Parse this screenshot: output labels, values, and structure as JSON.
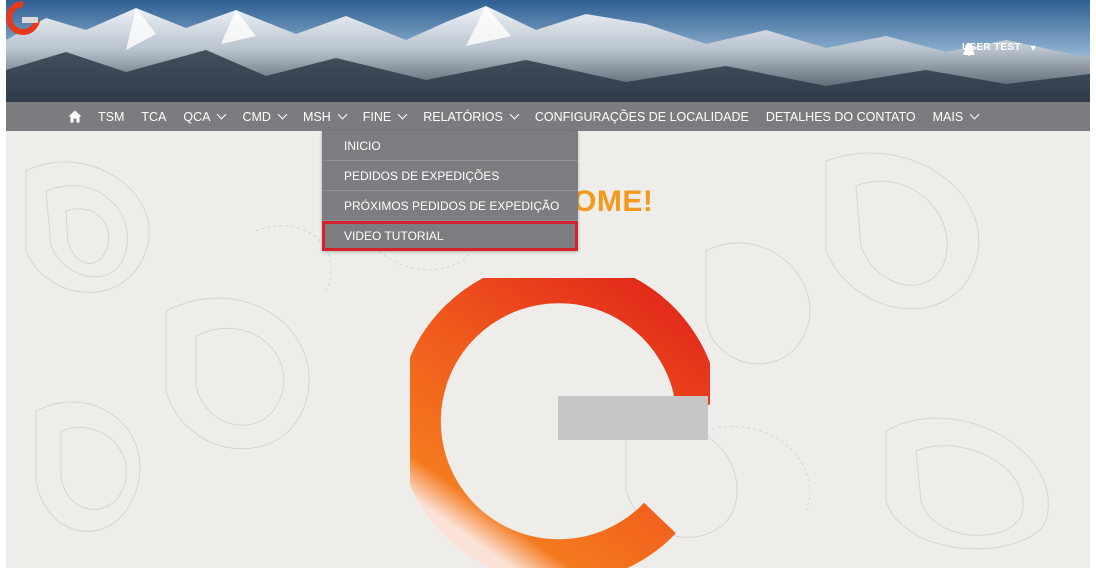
{
  "header": {
    "user_label": "USER TEST",
    "user_caret": "▼"
  },
  "nav": {
    "items": [
      {
        "label": "TSM",
        "dropdown": false
      },
      {
        "label": "TCA",
        "dropdown": false
      },
      {
        "label": "QCA",
        "dropdown": true
      },
      {
        "label": "CMD",
        "dropdown": true
      },
      {
        "label": "MSH",
        "dropdown": true
      },
      {
        "label": "FINE",
        "dropdown": true
      },
      {
        "label": "RELATÓRIOS",
        "dropdown": true
      },
      {
        "label": "CONFIGURAÇÕES DE LOCALIDADE",
        "dropdown": false
      },
      {
        "label": "DETALHES DO CONTATO",
        "dropdown": false
      },
      {
        "label": "MAIS",
        "dropdown": true
      }
    ]
  },
  "dropdown": {
    "items": [
      {
        "label": "INICIO"
      },
      {
        "label": "PEDIDOS DE EXPEDIÇÕES"
      },
      {
        "label": "PRÓXIMOS PEDIDOS DE EXPEDIÇÃO"
      },
      {
        "label": "VIDEO TUTORIAL"
      }
    ]
  },
  "main": {
    "welcome_visible": "OME!"
  },
  "colors": {
    "brand_orange": "#f39a1d",
    "brand_red": "#e8391c",
    "nav_gray": "#7a7c7f",
    "highlight_red": "#d3222c"
  },
  "icons": [
    "home-icon",
    "notification-icon",
    "user-icon",
    "chevron-down-icon"
  ]
}
